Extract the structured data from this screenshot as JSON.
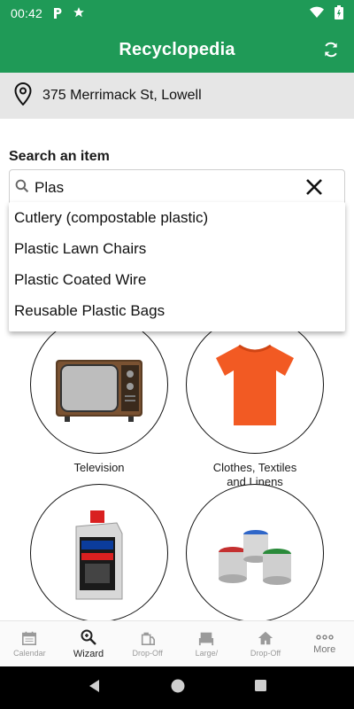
{
  "status_bar": {
    "time": "00:42"
  },
  "app_bar": {
    "title": "Recyclopedia"
  },
  "location": {
    "address": "375 Merrimack St, Lowell"
  },
  "search": {
    "label": "Search an item",
    "value": "Plas",
    "suggestions": [
      "Cutlery (compostable plastic)",
      "Plastic Lawn Chairs",
      "Plastic Coated Wire",
      "Reusable Plastic Bags"
    ]
  },
  "categories": [
    {
      "label": "Television",
      "icon": "television-image"
    },
    {
      "label_line1": "Clothes, Textiles",
      "label_line2": "and Linens",
      "icon": "tshirt-image"
    },
    {
      "label": "",
      "icon": "motor-oil-image"
    },
    {
      "label": "",
      "icon": "paint-cans-image"
    }
  ],
  "bottom_nav": {
    "items": [
      {
        "label": "Calendar",
        "icon": "calendar-icon"
      },
      {
        "label": "Wizard",
        "icon": "wizard-search-icon",
        "active": true
      },
      {
        "label": "Drop-Off",
        "icon": "drop-off-icon"
      },
      {
        "label": "Large/",
        "icon": "large-item-icon"
      },
      {
        "label": "Drop-Off",
        "icon": "home-drop-off-icon"
      },
      {
        "label": "More",
        "icon": "more-icon"
      }
    ]
  },
  "colors": {
    "brand_green": "#1f9a57",
    "location_bg": "#e6e6e6",
    "nav_bg": "#fafafa"
  }
}
